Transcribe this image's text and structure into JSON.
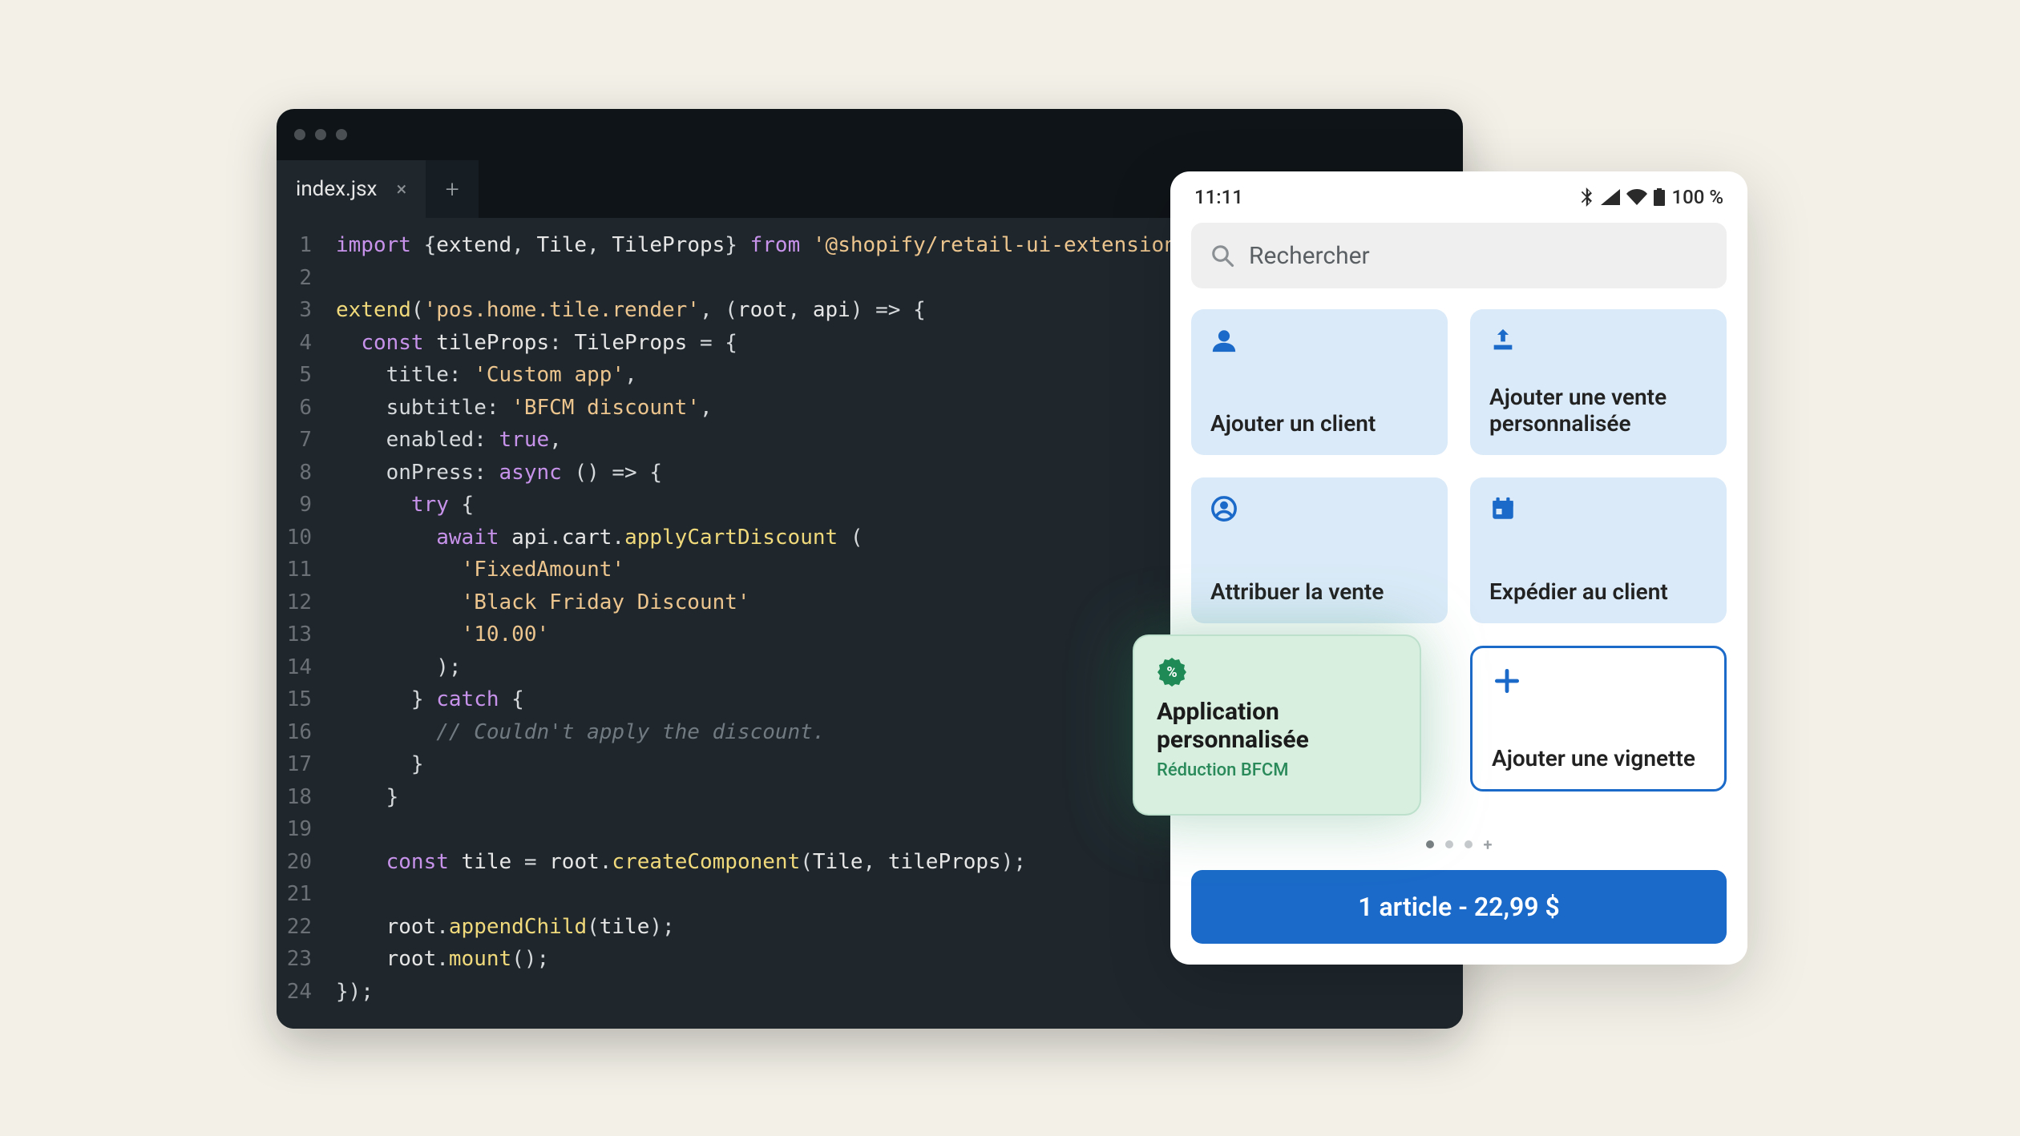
{
  "editor": {
    "tab_name": "index.jsx",
    "lines": [
      {
        "n": 1,
        "seg": [
          [
            "kw",
            "import "
          ],
          [
            "punc",
            "{"
          ],
          [
            "fn",
            "extend"
          ],
          [
            "punc",
            ", "
          ],
          [
            "fn",
            "Tile"
          ],
          [
            "punc",
            ", "
          ],
          [
            "fn",
            "TileProps"
          ],
          [
            "punc",
            "} "
          ],
          [
            "kw",
            "from "
          ],
          [
            "str",
            "'@shopify/retail-ui-extensions'"
          ],
          [
            "punc",
            ";"
          ]
        ]
      },
      {
        "n": 2,
        "seg": []
      },
      {
        "n": 3,
        "seg": [
          [
            "call",
            "extend"
          ],
          [
            "punc",
            "("
          ],
          [
            "str",
            "'pos.home.tile.render'"
          ],
          [
            "punc",
            ", ("
          ],
          [
            "fn",
            "root"
          ],
          [
            "punc",
            ", "
          ],
          [
            "fn",
            "api"
          ],
          [
            "punc",
            ") => {"
          ]
        ]
      },
      {
        "n": 4,
        "seg": [
          [
            "punc",
            "  "
          ],
          [
            "kw",
            "const "
          ],
          [
            "fn",
            "tileProps"
          ],
          [
            "punc",
            ": "
          ],
          [
            "fn",
            "TileProps"
          ],
          [
            "punc",
            " = {"
          ]
        ]
      },
      {
        "n": 5,
        "seg": [
          [
            "punc",
            "    "
          ],
          [
            "prop",
            "title"
          ],
          [
            "punc",
            ": "
          ],
          [
            "str",
            "'Custom app'"
          ],
          [
            "punc",
            ","
          ]
        ]
      },
      {
        "n": 6,
        "seg": [
          [
            "punc",
            "    "
          ],
          [
            "prop",
            "subtitle"
          ],
          [
            "punc",
            ": "
          ],
          [
            "str",
            "'BFCM discount'"
          ],
          [
            "punc",
            ","
          ]
        ]
      },
      {
        "n": 7,
        "seg": [
          [
            "punc",
            "    "
          ],
          [
            "prop",
            "enabled"
          ],
          [
            "punc",
            ": "
          ],
          [
            "bool",
            "true"
          ],
          [
            "punc",
            ","
          ]
        ]
      },
      {
        "n": 8,
        "seg": [
          [
            "punc",
            "    "
          ],
          [
            "prop",
            "onPress"
          ],
          [
            "punc",
            ": "
          ],
          [
            "kw",
            "async "
          ],
          [
            "punc",
            "() => {"
          ]
        ]
      },
      {
        "n": 9,
        "seg": [
          [
            "punc",
            "      "
          ],
          [
            "kw",
            "try "
          ],
          [
            "punc",
            "{"
          ]
        ]
      },
      {
        "n": 10,
        "seg": [
          [
            "punc",
            "        "
          ],
          [
            "kw",
            "await "
          ],
          [
            "fn",
            "api"
          ],
          [
            "punc",
            "."
          ],
          [
            "fn",
            "cart"
          ],
          [
            "punc",
            "."
          ],
          [
            "call",
            "applyCartDiscount"
          ],
          [
            "punc",
            " ("
          ]
        ]
      },
      {
        "n": 11,
        "seg": [
          [
            "punc",
            "          "
          ],
          [
            "str",
            "'FixedAmount'"
          ]
        ]
      },
      {
        "n": 12,
        "seg": [
          [
            "punc",
            "          "
          ],
          [
            "str",
            "'Black Friday Discount'"
          ]
        ]
      },
      {
        "n": 13,
        "seg": [
          [
            "punc",
            "          "
          ],
          [
            "str",
            "'10.00'"
          ]
        ]
      },
      {
        "n": 14,
        "seg": [
          [
            "punc",
            "        );"
          ]
        ]
      },
      {
        "n": 15,
        "seg": [
          [
            "punc",
            "      } "
          ],
          [
            "kw",
            "catch "
          ],
          [
            "punc",
            "{"
          ]
        ]
      },
      {
        "n": 16,
        "seg": [
          [
            "punc",
            "        "
          ],
          [
            "cmt",
            "// Couldn't apply the discount."
          ]
        ]
      },
      {
        "n": 17,
        "seg": [
          [
            "punc",
            "      }"
          ]
        ]
      },
      {
        "n": 18,
        "seg": [
          [
            "punc",
            "    }"
          ]
        ]
      },
      {
        "n": 19,
        "seg": []
      },
      {
        "n": 20,
        "seg": [
          [
            "punc",
            "    "
          ],
          [
            "kw",
            "const "
          ],
          [
            "fn",
            "tile"
          ],
          [
            "punc",
            " = "
          ],
          [
            "fn",
            "root"
          ],
          [
            "punc",
            "."
          ],
          [
            "call",
            "createComponent"
          ],
          [
            "punc",
            "("
          ],
          [
            "fn",
            "Tile"
          ],
          [
            "punc",
            ", "
          ],
          [
            "fn",
            "tileProps"
          ],
          [
            "punc",
            ");"
          ]
        ]
      },
      {
        "n": 21,
        "seg": []
      },
      {
        "n": 22,
        "seg": [
          [
            "punc",
            "    "
          ],
          [
            "fn",
            "root"
          ],
          [
            "punc",
            "."
          ],
          [
            "call",
            "appendChild"
          ],
          [
            "punc",
            "("
          ],
          [
            "fn",
            "tile"
          ],
          [
            "punc",
            ");"
          ]
        ]
      },
      {
        "n": 23,
        "seg": [
          [
            "punc",
            "    "
          ],
          [
            "fn",
            "root"
          ],
          [
            "punc",
            "."
          ],
          [
            "call",
            "mount"
          ],
          [
            "punc",
            "();"
          ]
        ]
      },
      {
        "n": 24,
        "seg": [
          [
            "punc",
            "});"
          ]
        ]
      }
    ]
  },
  "phone": {
    "status": {
      "time": "11:11",
      "battery": "100 %"
    },
    "search_placeholder": "Rechercher",
    "tiles": {
      "add_customer": "Ajouter un client",
      "add_custom_sale": "Ajouter une vente personnalisée",
      "attribute_sale": "Attribuer la vente",
      "ship_to_customer": "Expédier au client",
      "add_tile": "Ajouter une vignette"
    },
    "cart_button": "1 article - 22,99 $"
  },
  "custom_tile": {
    "title": "Application personnalisée",
    "subtitle": "Réduction BFCM",
    "badge_glyph": "%"
  }
}
